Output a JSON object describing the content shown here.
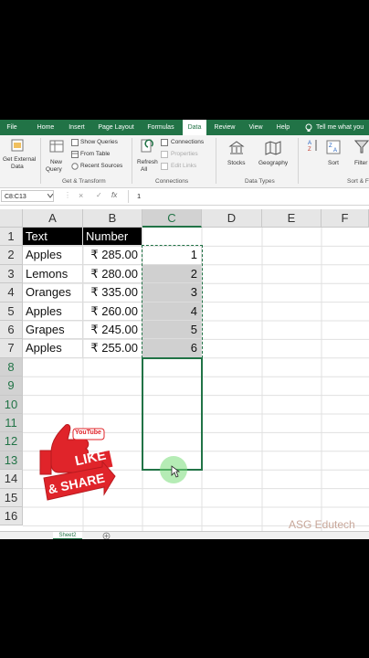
{
  "tabs": [
    "File",
    "Home",
    "Insert",
    "Page Layout",
    "Formulas",
    "Data",
    "Review",
    "View",
    "Help",
    "Tell me what you"
  ],
  "active_tab": "Data",
  "ribbon": {
    "get_external": [
      "Get External",
      "Data"
    ],
    "new_query": [
      "New",
      "Query"
    ],
    "show_queries": "Show Queries",
    "from_table": "From Table",
    "recent_sources": "Recent Sources",
    "refresh": [
      "Refresh",
      "All"
    ],
    "connections": "Connections",
    "properties": "Properties",
    "edit_links": "Edit Links",
    "stocks": "Stocks",
    "geography": "Geography",
    "sort": "Sort",
    "filter": "Filter",
    "group_get_transform": "Get & Transform",
    "group_connections": "Connections",
    "group_data_types": "Data Types",
    "group_sort_filter": "Sort & F"
  },
  "formula_bar": {
    "name_box": "C8:C13",
    "cancel": "×",
    "enter": "✓",
    "fx": "fx",
    "value": "1"
  },
  "columns": [
    "A",
    "B",
    "C",
    "D",
    "E",
    "F"
  ],
  "rows": [
    "1",
    "2",
    "3",
    "4",
    "5",
    "6",
    "7",
    "8",
    "9",
    "10",
    "11",
    "12",
    "13",
    "14",
    "15",
    "16"
  ],
  "headers": {
    "text": "Text",
    "number": "Number"
  },
  "table": [
    {
      "text": "Apples",
      "number": "₹ 285.00",
      "c": "1"
    },
    {
      "text": "Lemons",
      "number": "₹ 280.00",
      "c": "2"
    },
    {
      "text": "Oranges",
      "number": "₹ 335.00",
      "c": "3"
    },
    {
      "text": "Apples",
      "number": "₹ 260.00",
      "c": "4"
    },
    {
      "text": "Grapes",
      "number": "₹ 245.00",
      "c": "5"
    },
    {
      "text": "Apples",
      "number": "₹ 255.00",
      "c": "6"
    }
  ],
  "sticker": {
    "brand": "YouTube",
    "like": "LIKE",
    "share": "& SHARE"
  },
  "sheet_tab": "Sheet2",
  "watermark": "ASG Edutech",
  "colors": {
    "excel_green": "#217346",
    "sticker_red": "#e0242a"
  }
}
